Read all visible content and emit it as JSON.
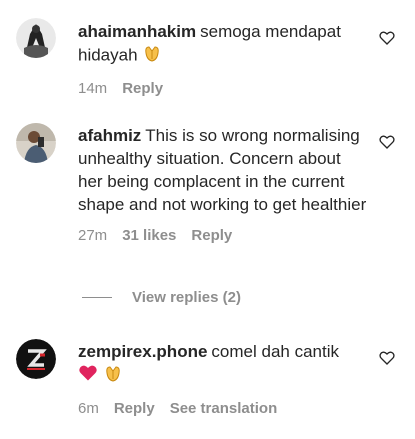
{
  "comments": [
    {
      "username": "ahaimanhakim",
      "text": "semoga mendapat hidayah",
      "emoji": "clap",
      "time": "14m",
      "reply": "Reply"
    },
    {
      "username": "afahmiz",
      "text": "This is so wrong normalising unhealthy situation. Concern about her being complacent in the current shape and not working to get healthier",
      "time": "27m",
      "likes": "31 likes",
      "reply": "Reply",
      "view_replies": "View replies (2)"
    },
    {
      "username": "zempirex.phone",
      "text": "comel dah cantik",
      "emoji": "heart-clap",
      "time": "6m",
      "reply": "Reply",
      "see_translation": "See translation"
    }
  ],
  "colors": {
    "text": "#262626",
    "muted": "#8e8e8e",
    "heart_red": "#ed4956",
    "clap_yellow": "#f7c04a"
  }
}
